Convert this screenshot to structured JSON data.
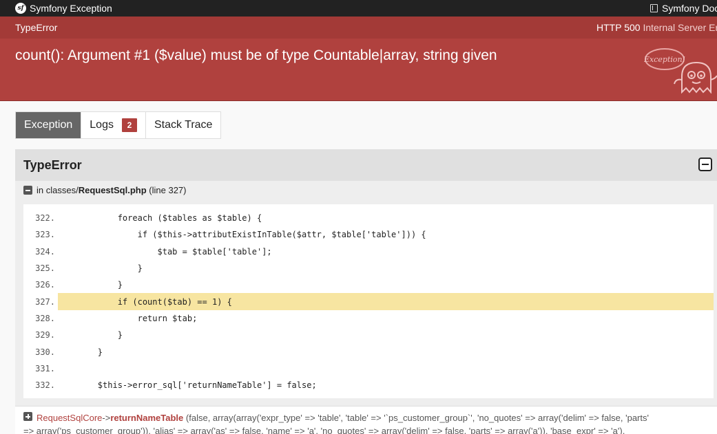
{
  "topbar": {
    "title": "Symfony Exception",
    "docs_label": "Symfony Docs",
    "logo_text": "sf"
  },
  "header": {
    "exception_class": "TypeError",
    "status_code": "HTTP 500",
    "status_text": "Internal Server Error",
    "message": "count(): Argument #1 ($value) must be of type Countable|array, string given",
    "mascot_bubble_text": "Exception!"
  },
  "tabs": [
    {
      "label": "Exception",
      "active": true
    },
    {
      "label": "Logs",
      "badge": "2"
    },
    {
      "label": "Stack Trace"
    }
  ],
  "panel": {
    "title": "TypeError",
    "file_prefix": "in classes/",
    "file_name": "RequestSql.php",
    "file_suffix": "(line 327)"
  },
  "code": [
    {
      "n": "322.",
      "text": "            foreach ($tables as $table) {"
    },
    {
      "n": "323.",
      "text": "                if ($this->attributExistInTable($attr, $table['table'])) {"
    },
    {
      "n": "324.",
      "text": "                    $tab = $table['table'];"
    },
    {
      "n": "325.",
      "text": "                }"
    },
    {
      "n": "326.",
      "text": "            }"
    },
    {
      "n": "327.",
      "text": "            if (count($tab) == 1) {",
      "highlight": true
    },
    {
      "n": "328.",
      "text": "                return $tab;"
    },
    {
      "n": "329.",
      "text": "            }"
    },
    {
      "n": "330.",
      "text": "        }"
    },
    {
      "n": "331.",
      "text": ""
    },
    {
      "n": "332.",
      "text": "        $this->error_sql['returnNameTable'] = false;"
    }
  ],
  "trace": {
    "class": "RequestSqlCore",
    "arrow": "->",
    "function": "returnNameTable",
    "args_line1": "(false, array(array('expr_type' => 'table', 'table' => '`ps_customer_group`', 'no_quotes' => array('delim' => false, 'parts'",
    "args_line2": "=> array('ps_customer_group')), 'alias' => array('as' => false, 'name' => 'a', 'no_quotes' => array('delim' => false, 'parts' => array('a')), 'base_expr' => 'a'),"
  }
}
